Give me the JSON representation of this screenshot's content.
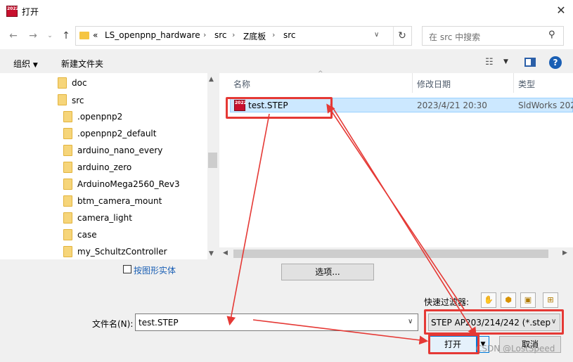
{
  "window": {
    "title": "打开",
    "app_icon_text": "2022"
  },
  "address": {
    "crumbs": [
      "LS_openpnp_hardware",
      "src",
      "Z底板",
      "src"
    ],
    "overflow": "«"
  },
  "search": {
    "placeholder": "在 src 中搜索"
  },
  "toolbar": {
    "organize": "组织",
    "new_folder": "新建文件夹"
  },
  "sidebar": {
    "items": [
      "doc",
      "src",
      ".openpnp2",
      ".openpnp2_default",
      "arduino_nano_every",
      "arduino_zero",
      "ArduinoMega2560_Rev3",
      "btm_camera_mount",
      "camera_light",
      "case",
      "my_SchultzController"
    ]
  },
  "columns": {
    "name": "名称",
    "date": "修改日期",
    "type": "类型"
  },
  "files": [
    {
      "name": "test.STEP",
      "date": "2023/4/21 20:30",
      "type": "SldWorks 202"
    }
  ],
  "options": {
    "checkbox_label": "按图形实体",
    "options_button": "选项...",
    "quick_filter_label": "快速过滤器:"
  },
  "bottom": {
    "filename_label": "文件名(N):",
    "filename_value": "test.STEP",
    "filter_value": "STEP AP203/214/242 (*.step;",
    "open_button": "打开",
    "cancel_button": "取消"
  },
  "watermark": "CSDN @LostSpeed",
  "colors": {
    "annotation": "#e53935",
    "selection": "#cce8ff",
    "help": "#1a5fb4"
  }
}
